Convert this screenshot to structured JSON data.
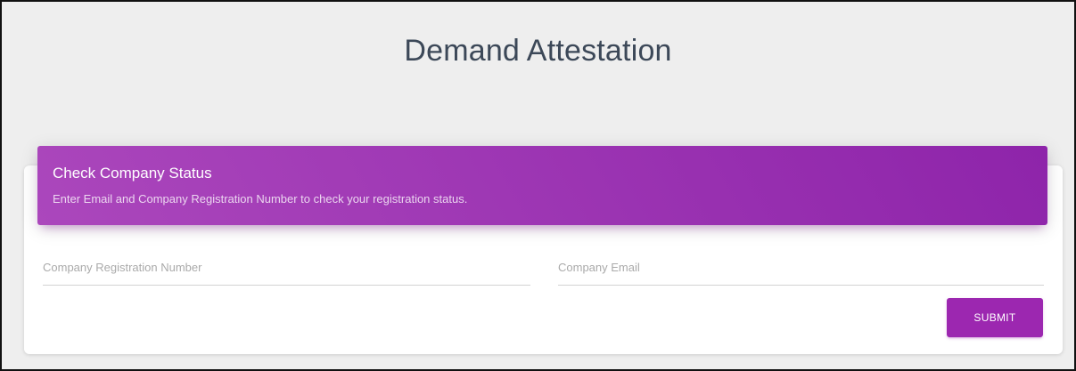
{
  "page": {
    "title": "Demand Attestation"
  },
  "card": {
    "header": {
      "title": "Check Company Status",
      "subtitle": "Enter Email and Company Registration Number to check your registration status."
    },
    "form": {
      "registration_number": {
        "placeholder": "Company Registration Number",
        "value": ""
      },
      "email": {
        "placeholder": "Company Email",
        "value": ""
      },
      "submit_label": "SUBMIT"
    }
  },
  "colors": {
    "background": "#eeeeee",
    "header_gradient_start": "#ab47bc",
    "header_gradient_end": "#8e24aa",
    "button": "#9c27b0",
    "title_text": "#3c4858"
  }
}
